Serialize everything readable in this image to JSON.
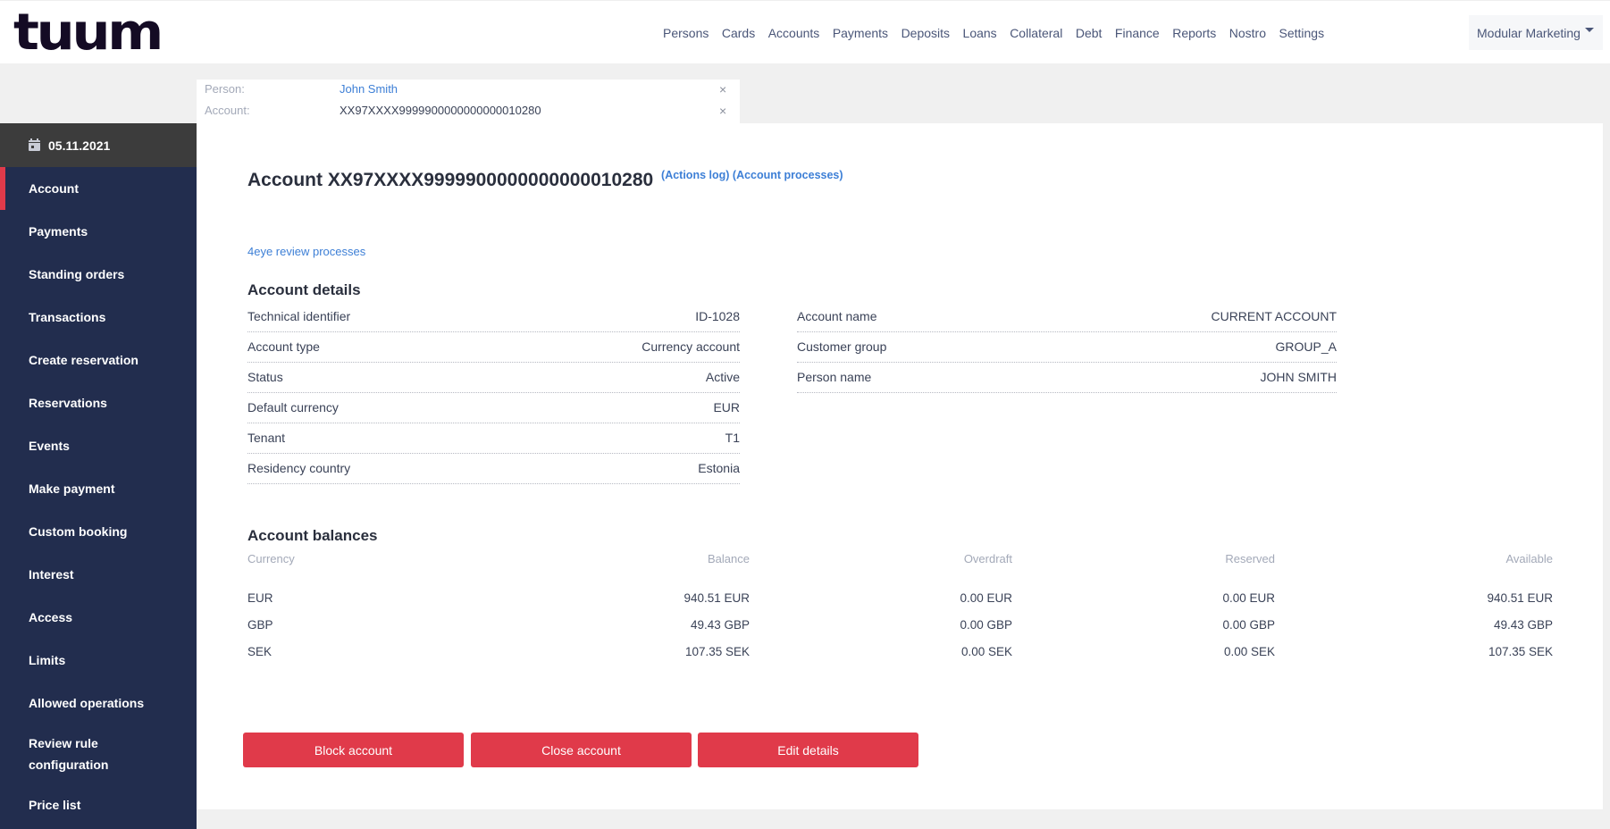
{
  "header": {
    "logo": "tuum",
    "nav": [
      "Persons",
      "Cards",
      "Accounts",
      "Payments",
      "Deposits",
      "Loans",
      "Collateral",
      "Debt",
      "Finance",
      "Reports",
      "Nostro",
      "Settings"
    ],
    "org_selector": "Modular Marketing"
  },
  "context": {
    "person_label": "Person:",
    "person_value": "John Smith",
    "account_label": "Account:",
    "account_value": "XX97XXXX9999900000000000010280",
    "close_glyph": "×"
  },
  "sidebar": {
    "date": "05.11.2021",
    "items": [
      {
        "label": "Account",
        "active": true
      },
      {
        "label": "Payments"
      },
      {
        "label": "Standing orders"
      },
      {
        "label": "Transactions"
      },
      {
        "label": "Create reservation"
      },
      {
        "label": "Reservations"
      },
      {
        "label": "Events"
      },
      {
        "label": "Make payment"
      },
      {
        "label": "Custom booking"
      },
      {
        "label": "Interest"
      },
      {
        "label": "Access"
      },
      {
        "label": "Limits"
      },
      {
        "label": "Allowed operations"
      },
      {
        "label": "Review rule configuration"
      },
      {
        "label": "Price list"
      }
    ]
  },
  "main": {
    "title": "Account XX97XXXX9999900000000000010280",
    "actions_log": "(Actions log)",
    "account_processes": "(Account processes)",
    "review_link": "4eye review processes",
    "details_title": "Account details",
    "details_left": [
      {
        "label": "Technical identifier",
        "value": "ID-1028"
      },
      {
        "label": "Account type",
        "value": "Currency account"
      },
      {
        "label": "Status",
        "value": "Active"
      },
      {
        "label": "Default currency",
        "value": "EUR"
      },
      {
        "label": "Tenant",
        "value": "T1"
      },
      {
        "label": "Residency country",
        "value": "Estonia"
      }
    ],
    "details_right": [
      {
        "label": "Account name",
        "value": "CURRENT ACCOUNT"
      },
      {
        "label": "Customer group",
        "value": "GROUP_A"
      },
      {
        "label": "Person name",
        "value": "JOHN SMITH"
      }
    ],
    "balances_title": "Account balances",
    "balances_columns": [
      "Currency",
      "Balance",
      "Overdraft",
      "Reserved",
      "Available"
    ],
    "balances_rows": [
      [
        "EUR",
        "940.51 EUR",
        "0.00 EUR",
        "0.00 EUR",
        "940.51 EUR"
      ],
      [
        "GBP",
        "49.43 GBP",
        "0.00 GBP",
        "0.00 GBP",
        "49.43 GBP"
      ],
      [
        "SEK",
        "107.35 SEK",
        "0.00 SEK",
        "0.00 SEK",
        "107.35 SEK"
      ]
    ],
    "buttons": {
      "block": "Block account",
      "close": "Close account",
      "edit": "Edit details"
    }
  },
  "colors": {
    "accent_red": "#e03a4a",
    "sidebar_bg": "#222d4e",
    "link_blue": "#3d7fd6"
  }
}
